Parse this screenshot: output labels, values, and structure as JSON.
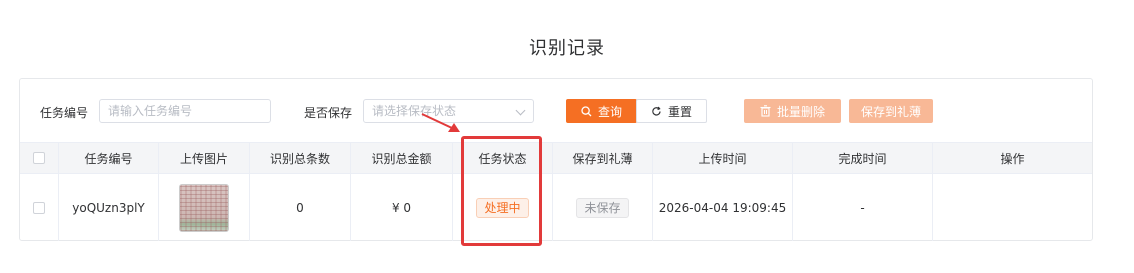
{
  "page_title": "识别记录",
  "filters": {
    "task_no_label": "任务编号",
    "task_no_placeholder": "请输入任务编号",
    "saved_label": "是否保存",
    "saved_placeholder": "请选择保存状态"
  },
  "toolbar": {
    "search_label": "查询",
    "reset_label": "重置",
    "batch_delete_label": "批量删除",
    "save_to_book_label": "保存到礼薄"
  },
  "table": {
    "headers": [
      "任务编号",
      "上传图片",
      "识别总条数",
      "识别总金额",
      "任务状态",
      "保存到礼薄",
      "上传时间",
      "完成时间",
      "操作"
    ],
    "rows": [
      {
        "task_no": "yoQUzn3plY",
        "total_count": "0",
        "total_amount": "¥ 0",
        "status": "处理中",
        "saved": "未保存",
        "upload_time": "2026-04-04 19:09:45",
        "finish_time": "-",
        "actions": ""
      }
    ]
  },
  "colors": {
    "accent": "#f56f23",
    "accent_disabled": "#f8b896",
    "highlight": "#e23a3a"
  },
  "icons": [
    "search-icon",
    "reset-icon",
    "trash-icon",
    "chevron-down-icon"
  ]
}
